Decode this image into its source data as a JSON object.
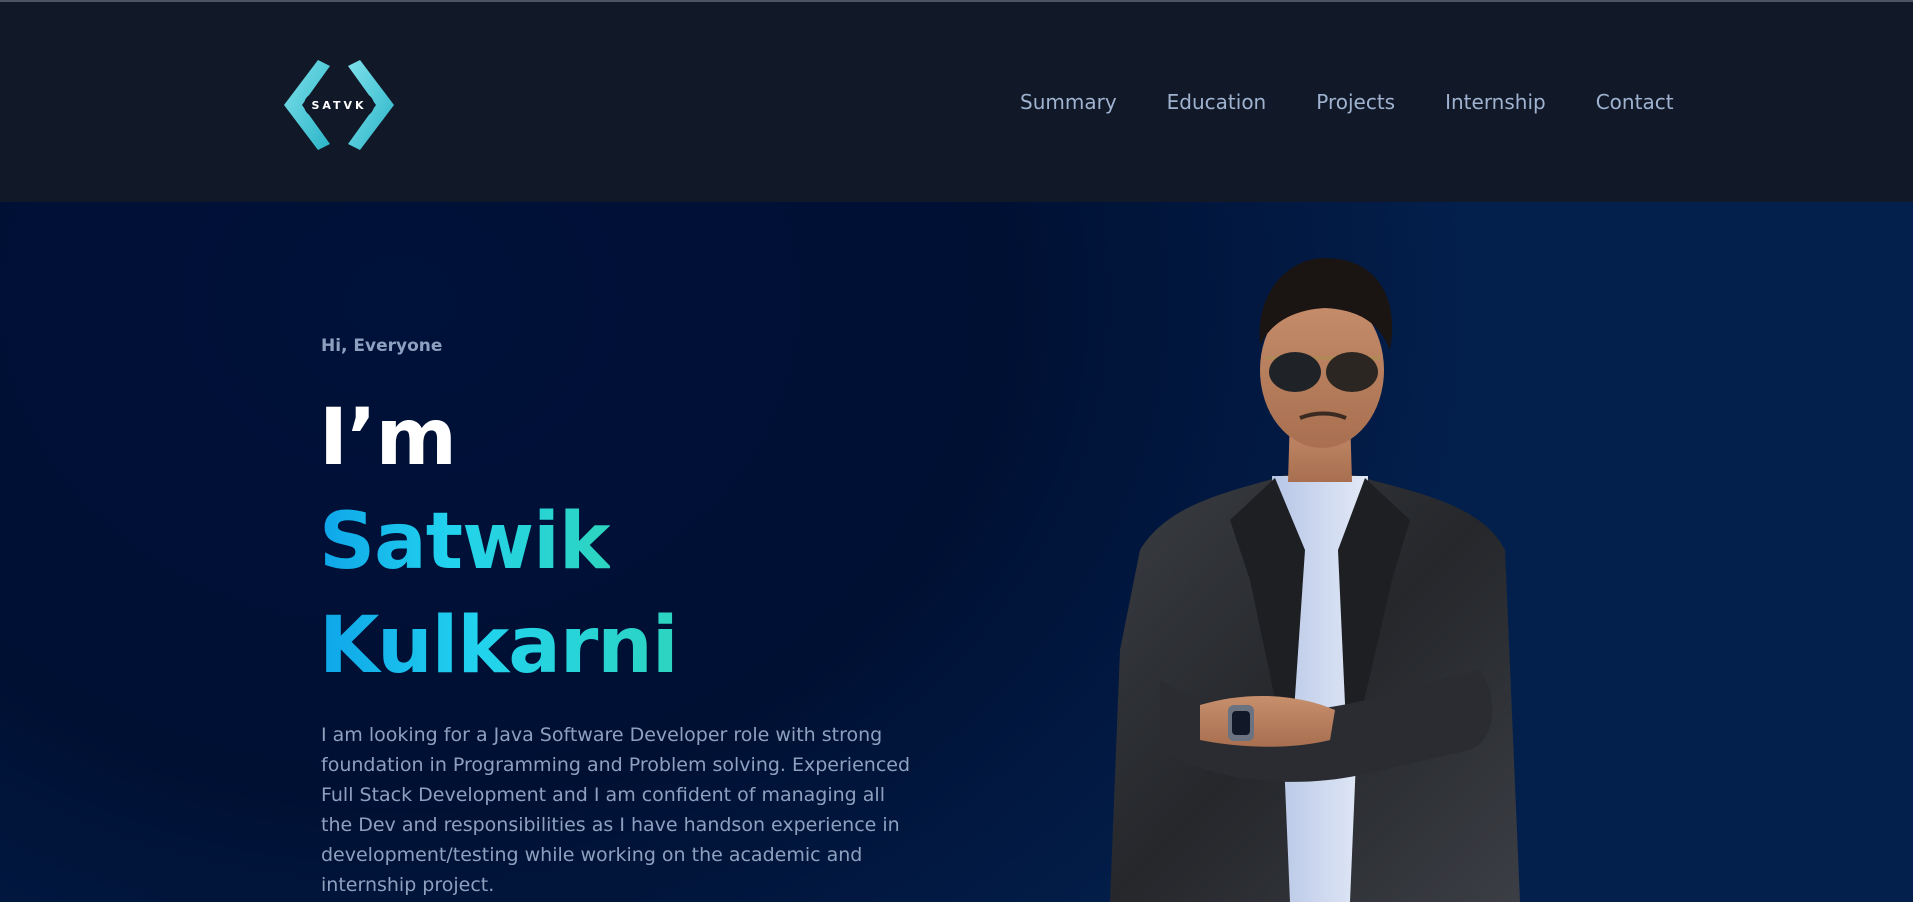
{
  "brand": {
    "logo_text": "SATVK"
  },
  "nav": {
    "items": [
      {
        "label": "Summary"
      },
      {
        "label": "Education"
      },
      {
        "label": "Projects"
      },
      {
        "label": "Internship"
      },
      {
        "label": "Contact"
      }
    ]
  },
  "hero": {
    "greeting": "Hi, Everyone",
    "intro": "I’m",
    "first_name": "Satwik",
    "last_name": "Kulkarni",
    "description": "I am looking for a Java Software Developer role with strong foundation in Programming and Problem solving. Experienced Full Stack Development and I am confident of managing all the Dev and responsibilities as I have handson experience in development/testing while working on the academic and internship project."
  },
  "colors": {
    "header_bg": "#111827",
    "hero_bg": "#001033",
    "accent_start": "#0ea5e9",
    "accent_end": "#2dd4bf",
    "muted_text": "#8ea0bf"
  }
}
